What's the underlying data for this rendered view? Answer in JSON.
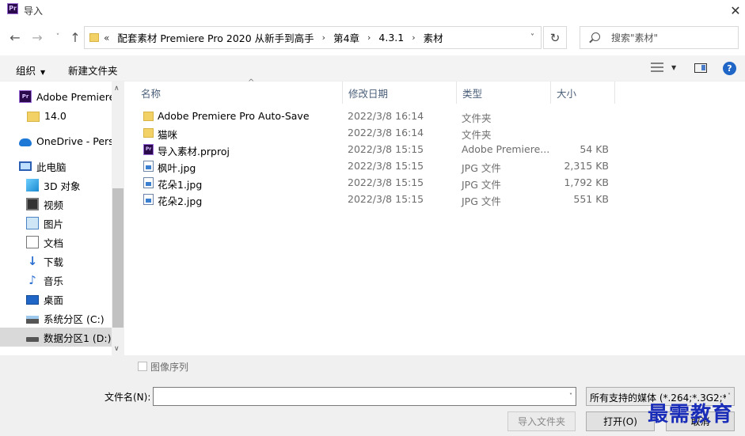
{
  "window": {
    "title": "导入",
    "close_glyph": "✕",
    "app_icon_text": "Pr"
  },
  "nav_buttons": {
    "back": "←",
    "forward": "→",
    "history": "˅",
    "up": "↑"
  },
  "address": {
    "overflow": "«",
    "crumbs": [
      "配套素材 Premiere Pro 2020 从新手到高手",
      "第4章",
      "4.3.1",
      "素材"
    ],
    "separator": "›",
    "dropdown": "˅",
    "refresh": "↻"
  },
  "search": {
    "placeholder": "搜索\"素材\""
  },
  "toolbar": {
    "organize": "组织",
    "new_folder": "新建文件夹",
    "caret": "▼",
    "help": "?"
  },
  "sidebar": {
    "items": [
      {
        "label": "Adobe Premiere",
        "icon": "premiere-icon"
      },
      {
        "label": "14.0",
        "icon": "folder-icon"
      },
      {
        "label": "OneDrive - Perso",
        "icon": "onedrive-icon"
      },
      {
        "label": "此电脑",
        "icon": "computer-icon"
      },
      {
        "label": "3D 对象",
        "icon": "3d-objects-icon"
      },
      {
        "label": "视频",
        "icon": "video-icon"
      },
      {
        "label": "图片",
        "icon": "pictures-icon"
      },
      {
        "label": "文档",
        "icon": "documents-icon"
      },
      {
        "label": "下载",
        "icon": "download-icon"
      },
      {
        "label": "音乐",
        "icon": "music-icon"
      },
      {
        "label": "桌面",
        "icon": "desktop-icon"
      },
      {
        "label": "系统分区 (C:)",
        "icon": "drive-c-icon"
      },
      {
        "label": "数据分区1 (D:)",
        "icon": "drive-d-icon"
      }
    ],
    "selected": "数据分区1 (D:)",
    "glyphs": {
      "down_arrow": "↓",
      "music_note": "♪",
      "scroll_up": "∧",
      "scroll_down": "∨"
    }
  },
  "filelist": {
    "columns": {
      "name": "名称",
      "date": "修改日期",
      "type": "类型",
      "size": "大小"
    },
    "sort_indicator": "^",
    "rows": [
      {
        "name": "Adobe Premiere Pro Auto-Save",
        "date": "2022/3/8 16:14",
        "type": "文件夹",
        "size": "",
        "icon": "folder-icon"
      },
      {
        "name": "猫咪",
        "date": "2022/3/8 16:14",
        "type": "文件夹",
        "size": "",
        "icon": "folder-icon"
      },
      {
        "name": "导入素材.prproj",
        "date": "2022/3/8 15:15",
        "type": "Adobe Premiere...",
        "size": "54 KB",
        "icon": "premiere-project-icon"
      },
      {
        "name": "枫叶.jpg",
        "date": "2022/3/8 15:15",
        "type": "JPG 文件",
        "size": "2,315 KB",
        "icon": "image-file-icon"
      },
      {
        "name": "花朵1.jpg",
        "date": "2022/3/8 15:15",
        "type": "JPG 文件",
        "size": "1,792 KB",
        "icon": "image-file-icon"
      },
      {
        "name": "花朵2.jpg",
        "date": "2022/3/8 15:15",
        "type": "JPG 文件",
        "size": "551 KB",
        "icon": "image-file-icon"
      }
    ]
  },
  "bottom": {
    "image_sequence": "图像序列",
    "filename_label": "文件名(N):",
    "filename_value": "",
    "filetype_value": "所有支持的媒体 (*.264;*.3G2;*",
    "dropdown": "˅",
    "import_folder": "导入文件夹",
    "open": "打开(O)",
    "cancel": "取消"
  },
  "watermark": "最需教育",
  "colors": {
    "accent": "#1f66c6",
    "watermark": "#1a2db8",
    "selected_bg": "#d9d9d9",
    "toolbar_bg": "#f3f3f3"
  }
}
